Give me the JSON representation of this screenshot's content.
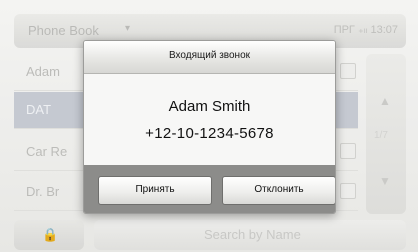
{
  "background_app": {
    "title": "Phone Book",
    "chevron_glyph": "▾",
    "status_text": "ПРГ ₊ₗₗ 13:07",
    "rows": [
      {
        "label": "Adam"
      },
      {
        "label": "DAT"
      },
      {
        "label": "Car Re"
      },
      {
        "label": "Dr. Br"
      }
    ],
    "scroll": {
      "up_glyph": "▲",
      "down_glyph": "▼",
      "position": "1/7"
    },
    "lock_glyph": "🔒",
    "search_placeholder": "Search by Name"
  },
  "dialog": {
    "title": "Входящий звонок",
    "caller_name": "Adam Smith",
    "caller_number": "+12-10-1234-5678",
    "accept_label": "Принять",
    "decline_label": "Отклонить"
  }
}
